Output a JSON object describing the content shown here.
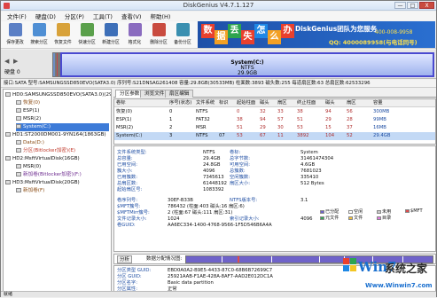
{
  "title": "DiskGenius V4.7.1.127",
  "window_controls": [
    "—",
    "□",
    "X"
  ],
  "menu": [
    "文件(F)",
    "硬盘(D)",
    "分区(P)",
    "工具(T)",
    "查看(V)",
    "帮助(H)"
  ],
  "toolbar": [
    {
      "label": "保存更改",
      "icon": "save-icon",
      "color": "#5b7fc5"
    },
    {
      "label": "搜索分区",
      "icon": "search-partition-icon",
      "color": "#4f8fd4"
    },
    {
      "label": "恢复文件",
      "icon": "recover-files-icon",
      "color": "#d8a23a"
    },
    {
      "label": "快速分区",
      "icon": "quick-partition-icon",
      "color": "#5aa04b"
    },
    {
      "label": "新建分区",
      "icon": "new-partition-icon",
      "color": "#3d6fb8"
    },
    {
      "label": "格式化",
      "icon": "format-icon",
      "color": "#8a6bbf"
    },
    {
      "label": "删除分区",
      "icon": "delete-partition-icon",
      "color": "#c94b3f"
    },
    {
      "label": "备份分区",
      "icon": "backup-partition-icon",
      "color": "#3a8fb0"
    }
  ],
  "banner": {
    "blocks": [
      "数",
      "据",
      "丢",
      "失",
      "怎",
      "么",
      "办"
    ],
    "block_colors": [
      "#e9402d",
      "#f3a023",
      "#2da44e",
      "#e9402d",
      "#1e88e5",
      "#f3a023",
      "#e9402d"
    ],
    "brand": "DiskGenius团队为您服务",
    "num": "400-008-9958",
    "phone": "QQ: 4000089958(与电话同号)"
  },
  "diskbar": {
    "nav": "◀",
    "nav2": "▶",
    "disk_label": "硬盘 0",
    "partition_label": "System(C:)",
    "partition_fs": "NTFS",
    "partition_size": "29.9GB"
  },
  "disk_info": "接口:SATA 型号:SAMSUNGSSD850EVO(SATA3.0) 序列号:S21DNSAG261408 容量:29.8GB(30533MB) 柱面数:3893 磁头数:255 每道扇区数:63 总扇区数:62533296",
  "tree": [
    {
      "text": "HD0:SAMSUNGSSD850EVO(SATA3.0)(29GB)",
      "indent": 0,
      "style": ""
    },
    {
      "text": "恢复(0)",
      "indent": 12,
      "style": "brown"
    },
    {
      "text": "ESP(1)",
      "indent": 12,
      "style": ""
    },
    {
      "text": "MSR(2)",
      "indent": 12,
      "style": ""
    },
    {
      "text": "System(C:)",
      "indent": 12,
      "style": "sel"
    },
    {
      "text": "HD1:ST2000DM001-9YN164(1863GB)",
      "indent": 0,
      "style": ""
    },
    {
      "text": "Data(D:)",
      "indent": 12,
      "style": "brown"
    },
    {
      "text": "分区(Bitlocker加密)(E)",
      "indent": 12,
      "style": "red"
    },
    {
      "text": "HD2:MsftVirtualDisk(16GB)",
      "indent": 0,
      "style": ""
    },
    {
      "text": "MSR(0)",
      "indent": 12,
      "style": ""
    },
    {
      "text": "新加卷(Bitlocker加密)(F:)",
      "indent": 12,
      "style": "purple"
    },
    {
      "text": "HD3:MsftVirtualDisk(20GB)",
      "indent": 0,
      "style": ""
    },
    {
      "text": "新加卷(F)",
      "indent": 12,
      "style": "brown"
    }
  ],
  "tabs": [
    "分区参数",
    "浏览文件",
    "扇区编辑"
  ],
  "table": {
    "headers": [
      "卷标",
      "序号(状态)",
      "文件系统",
      "标识",
      "起始柱面",
      "磁头",
      "扇区",
      "终止柱面",
      "磁头",
      "扇区",
      "容量"
    ],
    "rows": [
      [
        "恢复(0)",
        "0",
        "NTFS",
        "",
        "0",
        "32",
        "33",
        "38",
        "94",
        "56",
        "300MB"
      ],
      [
        "ESP(1)",
        "1",
        "FAT32",
        "",
        "38",
        "94",
        "57",
        "51",
        "29",
        "28",
        "99MB"
      ],
      [
        "MSR(2)",
        "2",
        "MSR",
        "",
        "51",
        "29",
        "30",
        "53",
        "15",
        "37",
        "16MB"
      ],
      [
        "System(C:)",
        "3",
        "NTFS",
        "07",
        "53",
        "67",
        "11",
        "3892",
        "104",
        "52",
        "29.4GB"
      ]
    ]
  },
  "details": {
    "left": [
      {
        "k": "文件系统类型:",
        "v": "NTFS",
        "k2": "卷标:",
        "v2": "System"
      },
      {
        "k": "总容量:",
        "v": "29.4GB",
        "k2": "总字节数:",
        "v2": "31461474304"
      },
      {
        "k": "已用空间:",
        "v": "24.8GB",
        "k2": "可用空间:",
        "v2": "4.6GB"
      },
      {
        "k": "簇大小:",
        "v": "4096",
        "k2": "总簇数:",
        "v2": "7681023"
      },
      {
        "k": "已用簇数:",
        "v": "7345613",
        "k2": "空闲簇数:",
        "v2": "335410"
      },
      {
        "k": "总扇区数:",
        "v": "61448192",
        "k2": "扇区大小:",
        "v2": "512 Bytes"
      },
      {
        "k": "起始扇区号:",
        "v": "1083392",
        "k2": "",
        "v2": ""
      }
    ],
    "lower": [
      {
        "k": "卷序列号:",
        "v": "30EF-B33B",
        "k2": "NTFS版本号:",
        "v2": "3.1"
      },
      {
        "k": "$MFT簇号:",
        "v": "786432 (柱面:403 磁头:16 扇区:6)",
        "k2": "",
        "v2": ""
      },
      {
        "k": "$MFTMirr簇号:",
        "v": "2 (柱面:67 磁头:111 扇区:31)",
        "k2": "",
        "v2": ""
      },
      {
        "k": "文件记录大小:",
        "v": "1024",
        "k2": "索引记录大小:",
        "v2": "4096"
      },
      {
        "k": "卷GUID:",
        "v": "AA6EC334-1400-4768-9566-1F5D546B6A4A",
        "k2": "",
        "v2": ""
      }
    ],
    "legend": [
      {
        "label": "已分配",
        "color": "#6f63c9"
      },
      {
        "label": "空闲",
        "color": "#ffffff"
      },
      {
        "label": "未用",
        "color": "#c8c8c8"
      },
      {
        "label": "$MFT",
        "color": "#e04b4b"
      },
      {
        "label": "元文件",
        "color": "#3aa35a"
      },
      {
        "label": "文件",
        "color": "#f0c040"
      },
      {
        "label": "目录",
        "color": "#e07ae0"
      }
    ]
  },
  "analysis": {
    "button": "分析",
    "label": "数据分配情况图:"
  },
  "bottom": [
    {
      "k": "分区类型 GUID:",
      "v": "EBD0A0A2-B9E5-4433-87C0-68B6B72699C7"
    },
    {
      "k": "分区 GUID:",
      "v": "25921AAB-F1AE-428A-8AF7-AAD2E012DC1A"
    },
    {
      "k": "分区名字:",
      "v": "Basic data partition"
    },
    {
      "k": "分区属性:",
      "v": "正常"
    }
  ],
  "status": "就绪",
  "watermark": {
    "text1": "Win7",
    "text2": "系统之家",
    "text3": "Www.Winwin7.com"
  }
}
